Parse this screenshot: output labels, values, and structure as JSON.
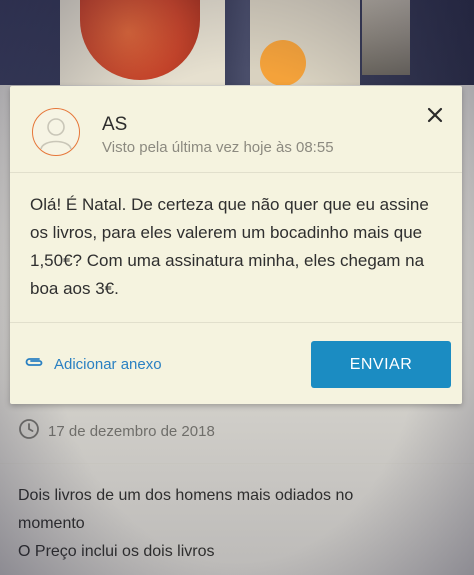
{
  "contact": {
    "name": "AS",
    "last_seen": "Visto pela última vez hoje às 08:55"
  },
  "message": {
    "text": "Olá! É Natal. De certeza que não quer que eu assine os livros, para eles valerem um bocadinho mais que 1,50€? Com uma assinatura minha, eles chegam na boa aos 3€."
  },
  "actions": {
    "attach_label": "Adicionar anexo",
    "send_label": "ENVIAR"
  },
  "listing": {
    "date": "17 de dezembro de 2018",
    "description_lines": [
      "Dois livros de um dos homens mais odiados no",
      "momento",
      "O Preço inclui os dois livros"
    ]
  },
  "colors": {
    "accent": "#1b8cc2",
    "link": "#2a80c2",
    "avatar_ring": "#e6773a",
    "modal_bg": "#f5f3df"
  }
}
